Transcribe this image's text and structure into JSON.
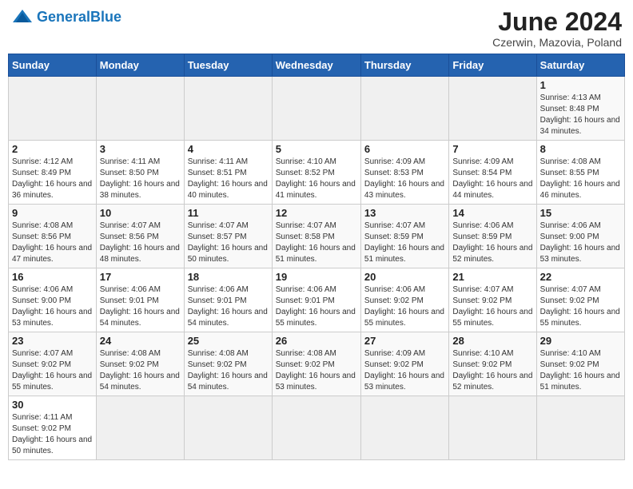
{
  "header": {
    "logo_general": "General",
    "logo_blue": "Blue",
    "month_title": "June 2024",
    "subtitle": "Czerwin, Mazovia, Poland"
  },
  "days_of_week": [
    "Sunday",
    "Monday",
    "Tuesday",
    "Wednesday",
    "Thursday",
    "Friday",
    "Saturday"
  ],
  "weeks": [
    [
      {
        "day": "",
        "info": ""
      },
      {
        "day": "",
        "info": ""
      },
      {
        "day": "",
        "info": ""
      },
      {
        "day": "",
        "info": ""
      },
      {
        "day": "",
        "info": ""
      },
      {
        "day": "",
        "info": ""
      },
      {
        "day": "1",
        "info": "Sunrise: 4:13 AM\nSunset: 8:48 PM\nDaylight: 16 hours and 34 minutes."
      }
    ],
    [
      {
        "day": "2",
        "info": "Sunrise: 4:12 AM\nSunset: 8:49 PM\nDaylight: 16 hours and 36 minutes."
      },
      {
        "day": "3",
        "info": "Sunrise: 4:11 AM\nSunset: 8:50 PM\nDaylight: 16 hours and 38 minutes."
      },
      {
        "day": "4",
        "info": "Sunrise: 4:11 AM\nSunset: 8:51 PM\nDaylight: 16 hours and 40 minutes."
      },
      {
        "day": "5",
        "info": "Sunrise: 4:10 AM\nSunset: 8:52 PM\nDaylight: 16 hours and 41 minutes."
      },
      {
        "day": "6",
        "info": "Sunrise: 4:09 AM\nSunset: 8:53 PM\nDaylight: 16 hours and 43 minutes."
      },
      {
        "day": "7",
        "info": "Sunrise: 4:09 AM\nSunset: 8:54 PM\nDaylight: 16 hours and 44 minutes."
      },
      {
        "day": "8",
        "info": "Sunrise: 4:08 AM\nSunset: 8:55 PM\nDaylight: 16 hours and 46 minutes."
      }
    ],
    [
      {
        "day": "9",
        "info": "Sunrise: 4:08 AM\nSunset: 8:56 PM\nDaylight: 16 hours and 47 minutes."
      },
      {
        "day": "10",
        "info": "Sunrise: 4:07 AM\nSunset: 8:56 PM\nDaylight: 16 hours and 48 minutes."
      },
      {
        "day": "11",
        "info": "Sunrise: 4:07 AM\nSunset: 8:57 PM\nDaylight: 16 hours and 50 minutes."
      },
      {
        "day": "12",
        "info": "Sunrise: 4:07 AM\nSunset: 8:58 PM\nDaylight: 16 hours and 51 minutes."
      },
      {
        "day": "13",
        "info": "Sunrise: 4:07 AM\nSunset: 8:59 PM\nDaylight: 16 hours and 51 minutes."
      },
      {
        "day": "14",
        "info": "Sunrise: 4:06 AM\nSunset: 8:59 PM\nDaylight: 16 hours and 52 minutes."
      },
      {
        "day": "15",
        "info": "Sunrise: 4:06 AM\nSunset: 9:00 PM\nDaylight: 16 hours and 53 minutes."
      }
    ],
    [
      {
        "day": "16",
        "info": "Sunrise: 4:06 AM\nSunset: 9:00 PM\nDaylight: 16 hours and 53 minutes."
      },
      {
        "day": "17",
        "info": "Sunrise: 4:06 AM\nSunset: 9:01 PM\nDaylight: 16 hours and 54 minutes."
      },
      {
        "day": "18",
        "info": "Sunrise: 4:06 AM\nSunset: 9:01 PM\nDaylight: 16 hours and 54 minutes."
      },
      {
        "day": "19",
        "info": "Sunrise: 4:06 AM\nSunset: 9:01 PM\nDaylight: 16 hours and 55 minutes."
      },
      {
        "day": "20",
        "info": "Sunrise: 4:06 AM\nSunset: 9:02 PM\nDaylight: 16 hours and 55 minutes."
      },
      {
        "day": "21",
        "info": "Sunrise: 4:07 AM\nSunset: 9:02 PM\nDaylight: 16 hours and 55 minutes."
      },
      {
        "day": "22",
        "info": "Sunrise: 4:07 AM\nSunset: 9:02 PM\nDaylight: 16 hours and 55 minutes."
      }
    ],
    [
      {
        "day": "23",
        "info": "Sunrise: 4:07 AM\nSunset: 9:02 PM\nDaylight: 16 hours and 55 minutes."
      },
      {
        "day": "24",
        "info": "Sunrise: 4:08 AM\nSunset: 9:02 PM\nDaylight: 16 hours and 54 minutes."
      },
      {
        "day": "25",
        "info": "Sunrise: 4:08 AM\nSunset: 9:02 PM\nDaylight: 16 hours and 54 minutes."
      },
      {
        "day": "26",
        "info": "Sunrise: 4:08 AM\nSunset: 9:02 PM\nDaylight: 16 hours and 53 minutes."
      },
      {
        "day": "27",
        "info": "Sunrise: 4:09 AM\nSunset: 9:02 PM\nDaylight: 16 hours and 53 minutes."
      },
      {
        "day": "28",
        "info": "Sunrise: 4:10 AM\nSunset: 9:02 PM\nDaylight: 16 hours and 52 minutes."
      },
      {
        "day": "29",
        "info": "Sunrise: 4:10 AM\nSunset: 9:02 PM\nDaylight: 16 hours and 51 minutes."
      }
    ],
    [
      {
        "day": "30",
        "info": "Sunrise: 4:11 AM\nSunset: 9:02 PM\nDaylight: 16 hours and 50 minutes."
      },
      {
        "day": "",
        "info": ""
      },
      {
        "day": "",
        "info": ""
      },
      {
        "day": "",
        "info": ""
      },
      {
        "day": "",
        "info": ""
      },
      {
        "day": "",
        "info": ""
      },
      {
        "day": "",
        "info": ""
      }
    ]
  ]
}
